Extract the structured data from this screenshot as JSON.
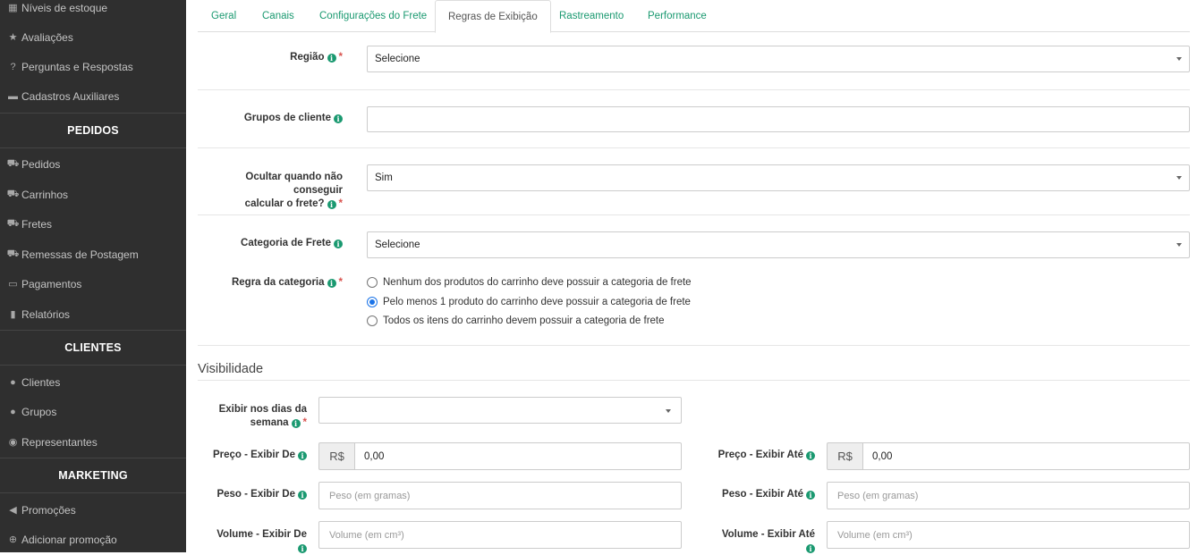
{
  "sidebar": {
    "items_top": [
      {
        "icon": "cubes-icon",
        "glyph": "▦",
        "label": "Níveis de estoque"
      },
      {
        "icon": "star-icon",
        "glyph": "★",
        "label": "Avaliações"
      },
      {
        "icon": "question-icon",
        "glyph": "?",
        "label": "Perguntas e Respostas"
      },
      {
        "icon": "file-icon",
        "glyph": "▬",
        "label": "Cadastros Auxiliares"
      }
    ],
    "section_orders": "PEDIDOS",
    "items_orders": [
      {
        "icon": "cart-icon",
        "glyph": "⛟",
        "label": "Pedidos"
      },
      {
        "icon": "shopping-cart-icon",
        "glyph": "⛟",
        "label": "Carrinhos"
      },
      {
        "icon": "truck-icon",
        "glyph": "⛟",
        "label": "Fretes"
      },
      {
        "icon": "truck-icon",
        "glyph": "⛟",
        "label": "Remessas de Postagem"
      },
      {
        "icon": "credit-card-icon",
        "glyph": "▭",
        "label": "Pagamentos"
      },
      {
        "icon": "bar-chart-icon",
        "glyph": "▮",
        "label": "Relatórios"
      }
    ],
    "section_clients": "CLIENTES",
    "items_clients": [
      {
        "icon": "user-icon",
        "glyph": "●",
        "label": "Clientes"
      },
      {
        "icon": "users-icon",
        "glyph": "●",
        "label": "Grupos"
      },
      {
        "icon": "user-circle-icon",
        "glyph": "◉",
        "label": "Representantes"
      }
    ],
    "section_marketing": "MARKETING",
    "items_marketing": [
      {
        "icon": "bullhorn-icon",
        "glyph": "◀",
        "label": "Promoções"
      },
      {
        "icon": "plus-circle-icon",
        "glyph": "⊕",
        "label": "Adicionar promoção"
      }
    ]
  },
  "tabs": [
    "Geral",
    "Canais",
    "Configurações do Frete",
    "Regras de Exibição",
    "Rastreamento",
    "Performance"
  ],
  "active_tab": "Regras de Exibição",
  "form": {
    "regiao_label": "Região",
    "regiao_value": "Selecione",
    "grupos_label": "Grupos de cliente",
    "grupos_value": "",
    "ocultar_label_1": "Ocultar quando não conseguir",
    "ocultar_label_2": "calcular o frete?",
    "ocultar_value": "Sim",
    "categoria_label": "Categoria de Frete",
    "categoria_value": "Selecione",
    "regra_label": "Regra da categoria",
    "regra_options": [
      "Nenhum dos produtos do carrinho deve possuir a categoria de frete",
      "Pelo menos 1 produto do carrinho deve possuir a categoria de frete",
      "Todos os itens do carrinho devem possuir a categoria de frete"
    ],
    "regra_selected": 1
  },
  "visibilidade": {
    "title": "Visibilidade",
    "dias_label_1": "Exibir nos dias da",
    "dias_label_2": "semana",
    "dias_value": "",
    "preco_de_label": "Preço - Exibir De",
    "preco_ate_label": "Preço - Exibir Até",
    "currency": "R$",
    "preco_de_value": "0,00",
    "preco_ate_value": "0,00",
    "peso_de_label": "Peso - Exibir De",
    "peso_ate_label": "Peso - Exibir Até",
    "peso_placeholder": "Peso (em gramas)",
    "volume_de_label": "Volume - Exibir De",
    "volume_ate_label": "Volume - Exibir Até",
    "volume_placeholder": "Volume (em cm³)"
  },
  "colors": {
    "sidebar_bg": "#2f2f2f",
    "accent": "#1a9970",
    "required": "#d9534f"
  }
}
